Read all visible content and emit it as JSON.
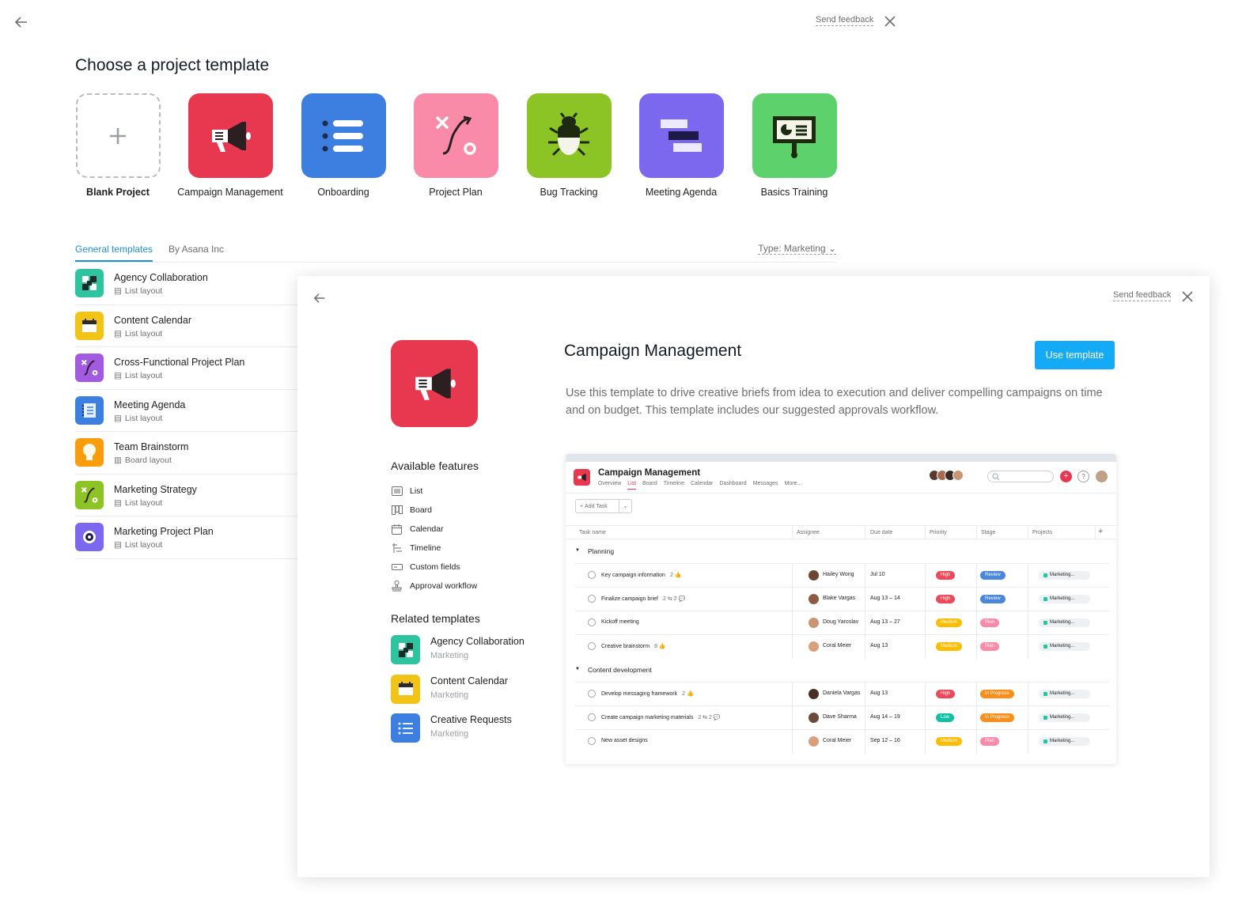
{
  "header": {
    "feedback": "Send feedback",
    "title": "Choose a project template"
  },
  "tiles": [
    {
      "label": "Blank Project",
      "color": "#ffffff",
      "icon": "plus-icon"
    },
    {
      "label": "Campaign Management",
      "color": "#e8384f",
      "icon": "megaphone-icon"
    },
    {
      "label": "Onboarding",
      "color": "#3d7fe0",
      "icon": "list-icon"
    },
    {
      "label": "Project Plan",
      "color": "#f98ba8",
      "icon": "path-icon"
    },
    {
      "label": "Bug Tracking",
      "color": "#8bc424",
      "icon": "bug-icon"
    },
    {
      "label": "Meeting Agenda",
      "color": "#7b68ee",
      "icon": "timeline-icon"
    },
    {
      "label": "Basics Training",
      "color": "#5dd16b",
      "icon": "presentation-icon"
    }
  ],
  "tabs": {
    "general": "General templates",
    "asana": "By Asana Inc",
    "type_filter": "Type: Marketing"
  },
  "templates": [
    {
      "name": "Agency Collaboration",
      "layout": "List layout",
      "color": "#2ec4a0",
      "icon": "puzzle-icon"
    },
    {
      "name": "Content Calendar",
      "layout": "List layout",
      "color": "#f2c418",
      "icon": "calendar-icon"
    },
    {
      "name": "Cross-Functional Project Plan",
      "layout": "List layout",
      "color": "#a15ae0",
      "icon": "path-icon"
    },
    {
      "name": "Meeting Agenda",
      "layout": "List layout",
      "color": "#3d7fe0",
      "icon": "notebook-icon"
    },
    {
      "name": "Team Brainstorm",
      "layout": "Board layout",
      "color": "#fb9c0c",
      "icon": "lightbulb-icon"
    },
    {
      "name": "Marketing Strategy",
      "layout": "List layout",
      "color": "#8bc424",
      "icon": "path-icon"
    },
    {
      "name": "Marketing Project Plan",
      "layout": "List layout",
      "color": "#7b68ee",
      "icon": "target-icon"
    }
  ],
  "modal": {
    "feedback": "Send feedback",
    "title": "Campaign Management",
    "use_button": "Use template",
    "description": "Use this template to drive creative briefs from idea to execution and deliver compelling campaigns on time and on budget. This template includes our suggested approvals workflow.",
    "features_heading": "Available features",
    "features": [
      "List",
      "Board",
      "Calendar",
      "Timeline",
      "Custom fields",
      "Approval workflow"
    ],
    "related_heading": "Related templates",
    "related": [
      {
        "name": "Agency Collaboration",
        "category": "Marketing",
        "color": "#2ec4a0",
        "icon": "puzzle-icon"
      },
      {
        "name": "Content Calendar",
        "category": "Marketing",
        "color": "#f2c418",
        "icon": "calendar-icon"
      },
      {
        "name": "Creative Requests",
        "category": "Marketing",
        "color": "#3d7fe0",
        "icon": "list-icon"
      }
    ]
  },
  "preview": {
    "title": "Campaign Management",
    "tabs": [
      "Overview",
      "List",
      "Board",
      "Timeline",
      "Calendar",
      "Dashboard",
      "Messages",
      "More..."
    ],
    "add_task": "Add Task",
    "columns": [
      "Task name",
      "Assignee",
      "Due date",
      "Priority",
      "Stage",
      "Projects"
    ],
    "sections": [
      {
        "name": "Planning",
        "rows": [
          {
            "task": "Key campaign information",
            "meta": "2 👍",
            "assignee": "Hailey Wong",
            "due": "Jul 10",
            "priority": "High",
            "stage": "Review",
            "project": "Marketing..."
          },
          {
            "task": "Finalize campaign brief",
            "meta": "2 ⇆ 2 💬",
            "assignee": "Blake Vargas",
            "due": "Aug 13 – 14",
            "priority": "High",
            "stage": "Review",
            "project": "Marketing..."
          },
          {
            "task": "Kickoff meeting",
            "meta": "",
            "assignee": "Doug Yaroslav",
            "due": "Aug 13 – 27",
            "priority": "Medium",
            "stage": "Plan",
            "project": "Marketing..."
          },
          {
            "task": "Creative brainstorm",
            "meta": "8 👍",
            "assignee": "Coral Meier",
            "due": "Aug 13",
            "priority": "Medium",
            "stage": "Plan",
            "project": "Marketing..."
          }
        ]
      },
      {
        "name": "Content development",
        "rows": [
          {
            "task": "Develop messaging framework",
            "meta": "2 👍",
            "assignee": "Daniela Vargas",
            "due": "Aug 13",
            "priority": "High",
            "stage": "In Progress",
            "project": "Marketing..."
          },
          {
            "task": "Create campaign marketing materials",
            "meta": "2 ⇆ 2 💬",
            "assignee": "Dave Sharma",
            "due": "Aug 14 – 19",
            "priority": "Low",
            "stage": "In Progress",
            "project": "Marketing..."
          },
          {
            "task": "New asset designs",
            "meta": "",
            "assignee": "Coral Meier",
            "due": "Sep 12 – 16",
            "priority": "Medium",
            "stage": "Plan",
            "project": "Marketing..."
          }
        ]
      }
    ]
  },
  "colors": {
    "accent": "#14aaf5",
    "tab_active": "#1e90d2",
    "High": "#f0485b",
    "Medium": "#fcbd01",
    "Low": "#11c0a4",
    "Review": "#4a86d9",
    "Plan": "#f98ba8",
    "In Progress": "#fb8d1a"
  }
}
